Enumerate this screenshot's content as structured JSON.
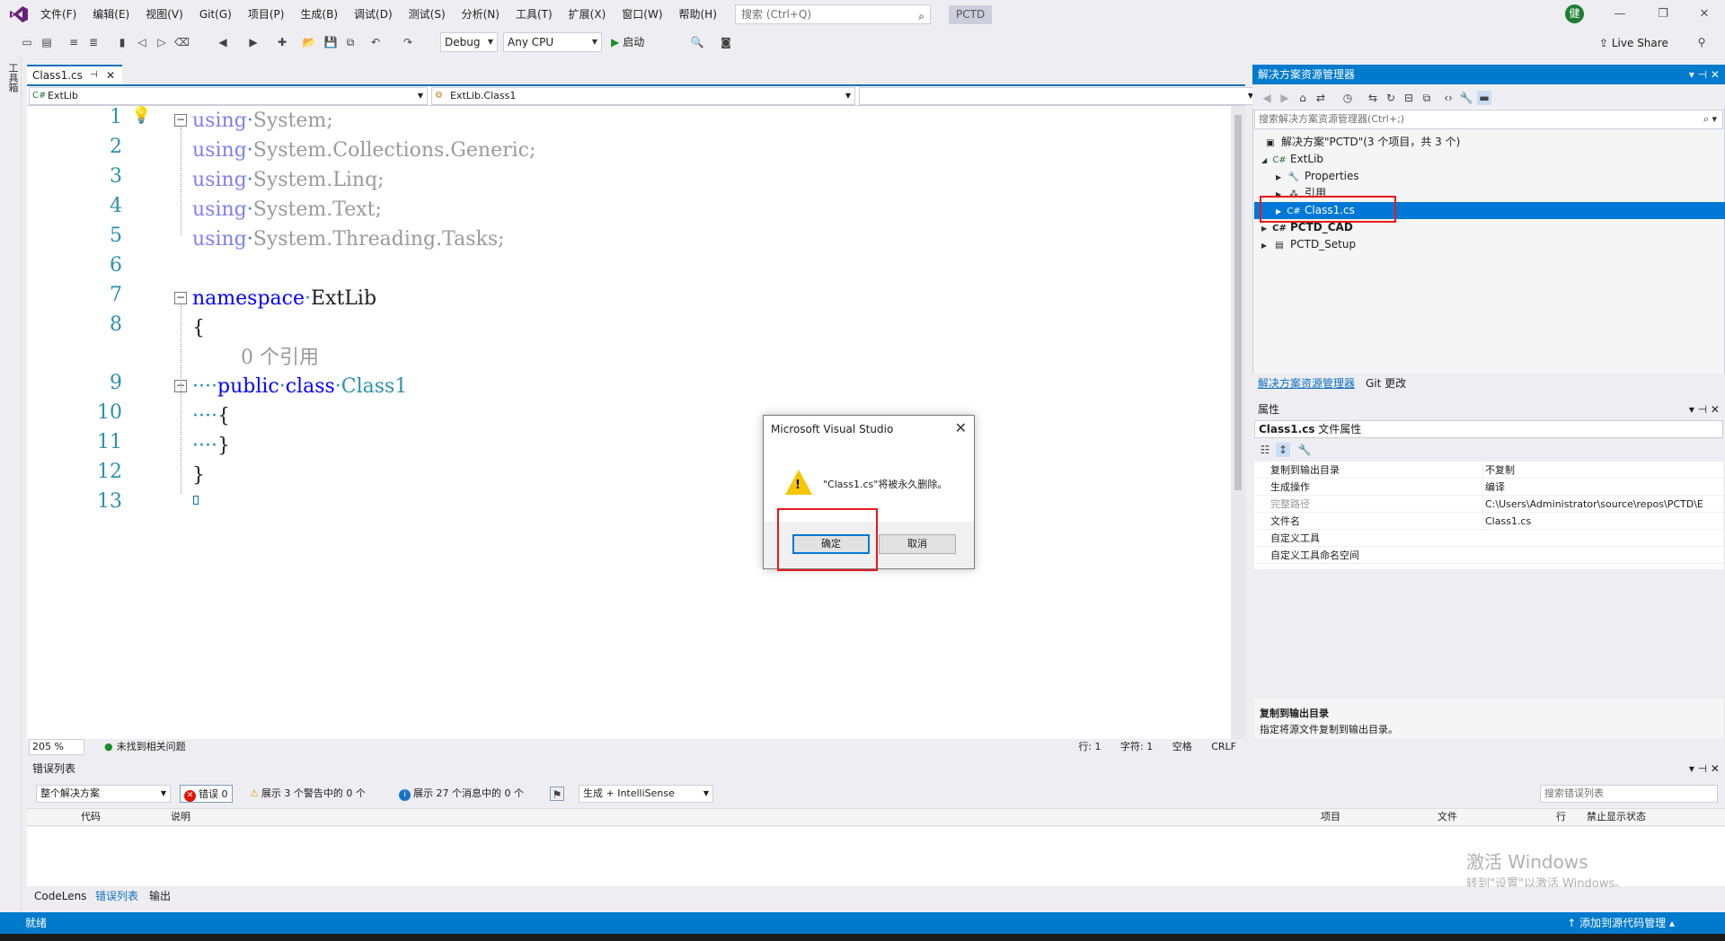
{
  "menu": {
    "items": [
      "文件(F)",
      "编辑(E)",
      "视图(V)",
      "Git(G)",
      "项目(P)",
      "生成(B)",
      "调试(D)",
      "测试(S)",
      "分析(N)",
      "工具(T)",
      "扩展(X)",
      "窗口(W)",
      "帮助(H)"
    ],
    "search_placeholder": "搜索 (Ctrl+Q)",
    "solution_name": "PCTD",
    "user_initial": "健"
  },
  "window_controls": {
    "minimize": "—",
    "restore": "❐",
    "close": "✕"
  },
  "toolbar": {
    "config": "Debug",
    "platform": "Any CPU",
    "start_label": "启动",
    "live_share": "Live Share"
  },
  "left_strip": {
    "label": "工具箱"
  },
  "editor": {
    "tab_title": "Class1.cs",
    "project_combo": "ExtLib",
    "class_combo": "ExtLib.Class1",
    "member_combo": "",
    "line_numbers": [
      "1",
      "2",
      "3",
      "4",
      "5",
      "6",
      "7",
      "8",
      "9",
      "10",
      "11",
      "12",
      "13"
    ],
    "codelens": "0 个引用",
    "zoom": "205 %",
    "issues": "未找到相关问题",
    "line_label": "行: 1",
    "char_label": "字符: 1",
    "whitespace": "空格",
    "eol": "CRLF"
  },
  "solution_explorer": {
    "title": "解决方案资源管理器",
    "search_placeholder": "搜索解决方案资源管理器(Ctrl+;)",
    "tree": {
      "solution": "解决方案\"PCTD\"(3 个项目，共 3 个)",
      "extlib": "ExtLib",
      "properties": "Properties",
      "references": "引用",
      "class1": "Class1.cs",
      "pctd_cad": "PCTD_CAD",
      "pctd_setup": "PCTD_Setup"
    },
    "tab_active": "解决方案资源管理器",
    "tab_other": "Git 更改"
  },
  "properties": {
    "title": "属性",
    "object_name": "Class1.cs",
    "object_type": "文件属性",
    "rows": [
      {
        "key": "复制到输出目录",
        "value": "不复制"
      },
      {
        "key": "生成操作",
        "value": "编译"
      },
      {
        "key": "完整路径",
        "value": "C:\\Users\\Administrator\\source\\repos\\PCTD\\E"
      },
      {
        "key": "文件名",
        "value": "Class1.cs"
      },
      {
        "key": "自定义工具",
        "value": ""
      },
      {
        "key": "自定义工具命名空间",
        "value": ""
      }
    ],
    "desc_title": "复制到输出目录",
    "desc_text": "指定将源文件复制到输出目录。"
  },
  "error_list": {
    "title": "错误列表",
    "scope": "整个解决方案",
    "errors": "错误 0",
    "warnings": "展示 3 个警告中的 0 个",
    "messages": "展示 27 个消息中的 0 个",
    "build_filter": "生成 + IntelliSense",
    "search_placeholder": "搜索错误列表",
    "columns": [
      "代码",
      "说明",
      "项目",
      "文件",
      "行",
      "禁止显示状态"
    ],
    "watermark_1": "激活 Windows",
    "watermark_2": "转到\"设置\"以激活 Windows。"
  },
  "bottom_tabs": [
    "CodeLens",
    "错误列表",
    "输出"
  ],
  "statusbar": {
    "status": "就绪",
    "add_source": "添加到源代码管理"
  },
  "dialog": {
    "title": "Microsoft Visual Studio",
    "message": "\"Class1.cs\"将被永久删除。",
    "ok": "确定",
    "cancel": "取消"
  },
  "colors": {
    "accent": "#007acc",
    "highlight_red": "#e8191c",
    "keyword": "#0000ff",
    "type": "#2b91af"
  }
}
